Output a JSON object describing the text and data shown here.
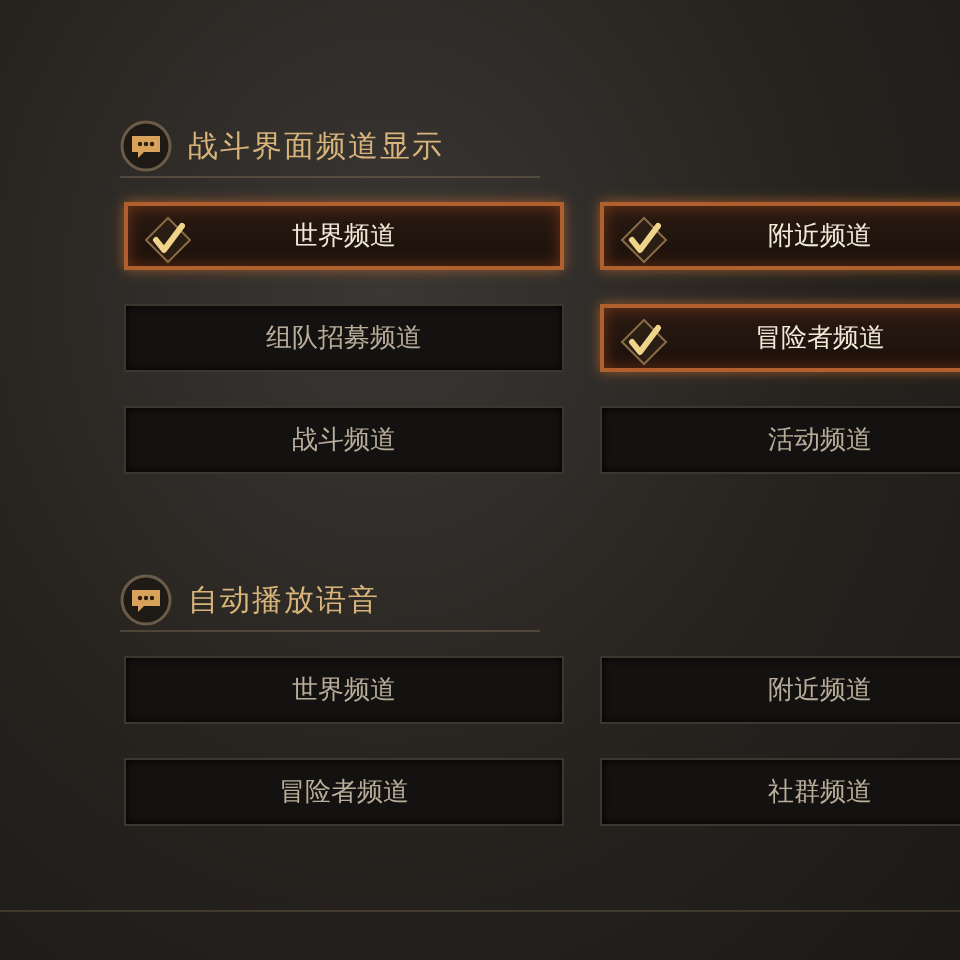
{
  "sections": [
    {
      "title": "战斗界面频道显示",
      "options": [
        {
          "label": "世界频道",
          "checked": true
        },
        {
          "label": "附近频道",
          "checked": true
        },
        {
          "label": "组队招募频道",
          "checked": false
        },
        {
          "label": "冒险者频道",
          "checked": true
        },
        {
          "label": "战斗频道",
          "checked": false
        },
        {
          "label": "活动频道",
          "checked": false
        }
      ]
    },
    {
      "title": "自动播放语音",
      "options": [
        {
          "label": "世界频道",
          "checked": false
        },
        {
          "label": "附近频道",
          "checked": false
        },
        {
          "label": "冒险者频道",
          "checked": false
        },
        {
          "label": "社群频道",
          "checked": false
        }
      ]
    }
  ]
}
